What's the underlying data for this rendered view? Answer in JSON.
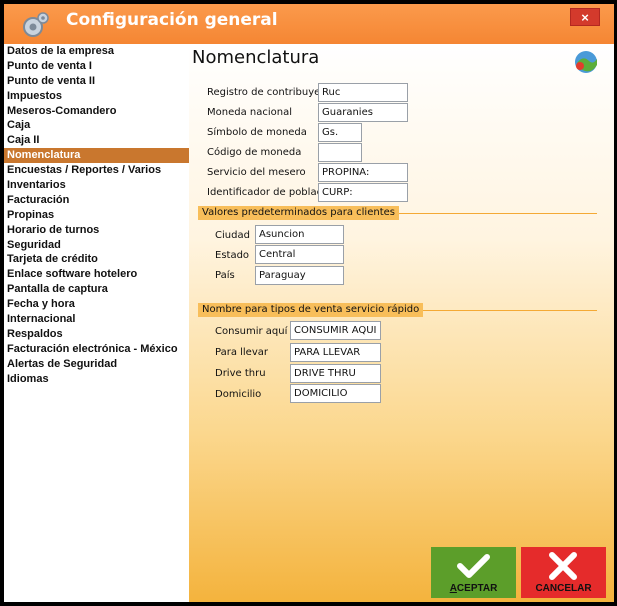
{
  "window": {
    "title": "Configuración general",
    "close_label": "×"
  },
  "sidebar": {
    "items": [
      {
        "label": "Datos de la empresa"
      },
      {
        "label": "Punto de venta I"
      },
      {
        "label": "Punto de venta II"
      },
      {
        "label": "Impuestos"
      },
      {
        "label": "Meseros-Comandero"
      },
      {
        "label": "Caja"
      },
      {
        "label": "Caja II"
      },
      {
        "label": "Nomenclatura",
        "selected": true
      },
      {
        "label": "Encuestas / Reportes / Varios"
      },
      {
        "label": "Inventarios"
      },
      {
        "label": "Facturación"
      },
      {
        "label": "Propinas"
      },
      {
        "label": "Horario de turnos"
      },
      {
        "label": "Seguridad"
      },
      {
        "label": "Tarjeta de crédito"
      },
      {
        "label": "Enlace software hotelero"
      },
      {
        "label": "Pantalla de captura"
      },
      {
        "label": "Fecha y hora"
      },
      {
        "label": "Internacional"
      },
      {
        "label": "Respaldos"
      },
      {
        "label": "Facturación electrónica - México"
      },
      {
        "label": "Alertas de Seguridad"
      },
      {
        "label": "Idiomas"
      }
    ]
  },
  "main": {
    "title": "Nomenclatura",
    "fields": {
      "registro": {
        "label": "Registro de contribuyente",
        "value": "Ruc"
      },
      "moneda": {
        "label": "Moneda nacional",
        "value": "Guaranies"
      },
      "simbolo": {
        "label": "Símbolo de moneda",
        "value": "Gs."
      },
      "codigo": {
        "label": "Código de moneda",
        "value": ""
      },
      "servicio": {
        "label": "Servicio del mesero",
        "value": "PROPINA:"
      },
      "identificador": {
        "label": "Identificador de población",
        "value": "CURP:"
      }
    },
    "clientes": {
      "header": "Valores predeterminados para clientes",
      "ciudad": {
        "label": "Ciudad",
        "value": "Asuncion"
      },
      "estado": {
        "label": "Estado",
        "value": "Central"
      },
      "pais": {
        "label": "País",
        "value": "Paraguay"
      }
    },
    "venta": {
      "header": "Nombre para tipos de venta servicio rápido",
      "consumir": {
        "label": "Consumir aquí",
        "value": "CONSUMIR AQUI"
      },
      "llevar": {
        "label": "Para llevar",
        "value": "PARA LLEVAR"
      },
      "drive": {
        "label": "Drive thru",
        "value": "DRIVE THRU"
      },
      "domicilio": {
        "label": "Domicilio",
        "value": "DOMICILIO"
      }
    }
  },
  "buttons": {
    "accept": "ACEPTAR",
    "cancel": "CANCELAR"
  },
  "colors": {
    "title_bar": "#f58633",
    "selected": "#c9772e",
    "accept": "#5c9e2a",
    "cancel": "#e52b2b"
  }
}
